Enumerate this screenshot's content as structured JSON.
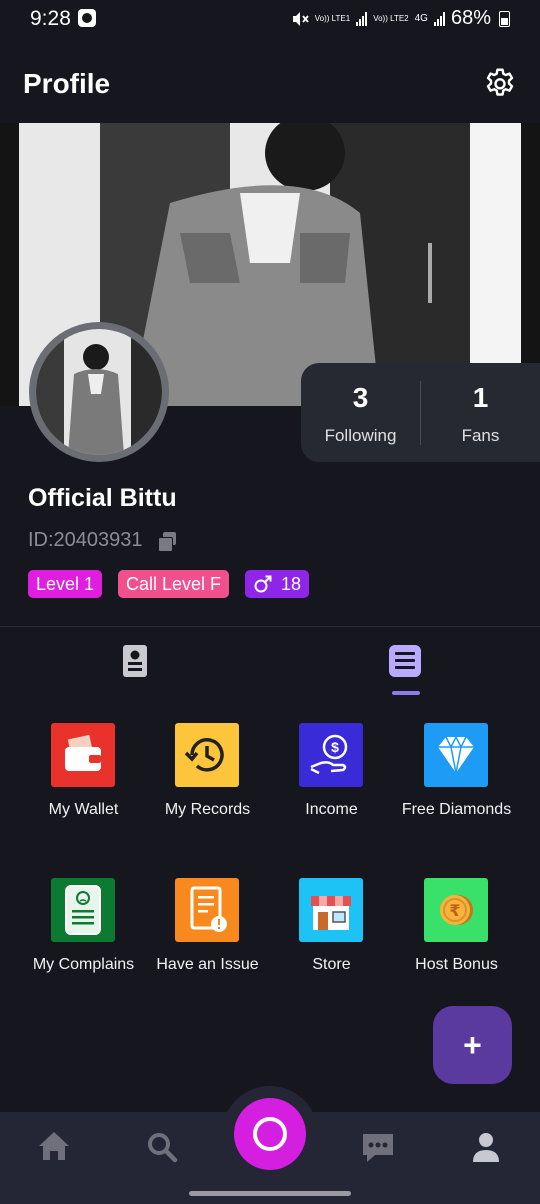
{
  "status_bar": {
    "time": "9:28",
    "sim1_label": "Vo)) LTE1",
    "sim2_label": "Vo)) LTE2",
    "network_type": "4G",
    "battery": "68%"
  },
  "header": {
    "title": "Profile",
    "settings_icon": "gear-icon"
  },
  "stats": {
    "following_count": "3",
    "following_label": "Following",
    "fans_count": "1",
    "fans_label": "Fans"
  },
  "profile": {
    "name": "Official Bittu",
    "id_text": "ID:20403931",
    "badges": {
      "level": "Level 1",
      "call_level": "Call Level F",
      "gender_icon": "male-icon",
      "age": "18"
    }
  },
  "tabs": [
    {
      "icon": "contact-card-icon",
      "selected": false
    },
    {
      "icon": "menu-list-icon",
      "selected": true
    }
  ],
  "menu_items": [
    {
      "label": "My Wallet",
      "icon": "wallet-icon",
      "color": "#e8322b"
    },
    {
      "label": "My Records",
      "icon": "history-clock-icon",
      "color": "#fcc53b"
    },
    {
      "label": "Income",
      "icon": "income-hand-coin-icon",
      "color": "#3a2bd8"
    },
    {
      "label": "Free Diamonds",
      "icon": "diamond-icon",
      "color": "#1e9bf5"
    },
    {
      "label": "My Complains",
      "icon": "complaint-document-icon",
      "color": "#0d7a32"
    },
    {
      "label": "Have an Issue",
      "icon": "issue-document-icon",
      "color": "#f7891e"
    },
    {
      "label": "Store",
      "icon": "store-icon",
      "color": "#1ec3f5"
    },
    {
      "label": "Host Bonus",
      "icon": "rupee-coin-icon",
      "color": "#39e06a"
    }
  ],
  "fab": {
    "label": "+"
  },
  "bottom_nav": [
    {
      "name": "home",
      "icon": "home-icon"
    },
    {
      "name": "search",
      "icon": "search-icon"
    },
    {
      "name": "live",
      "icon": "live-ring-icon"
    },
    {
      "name": "messages",
      "icon": "chat-bubble-icon"
    },
    {
      "name": "profile",
      "icon": "user-icon"
    }
  ]
}
